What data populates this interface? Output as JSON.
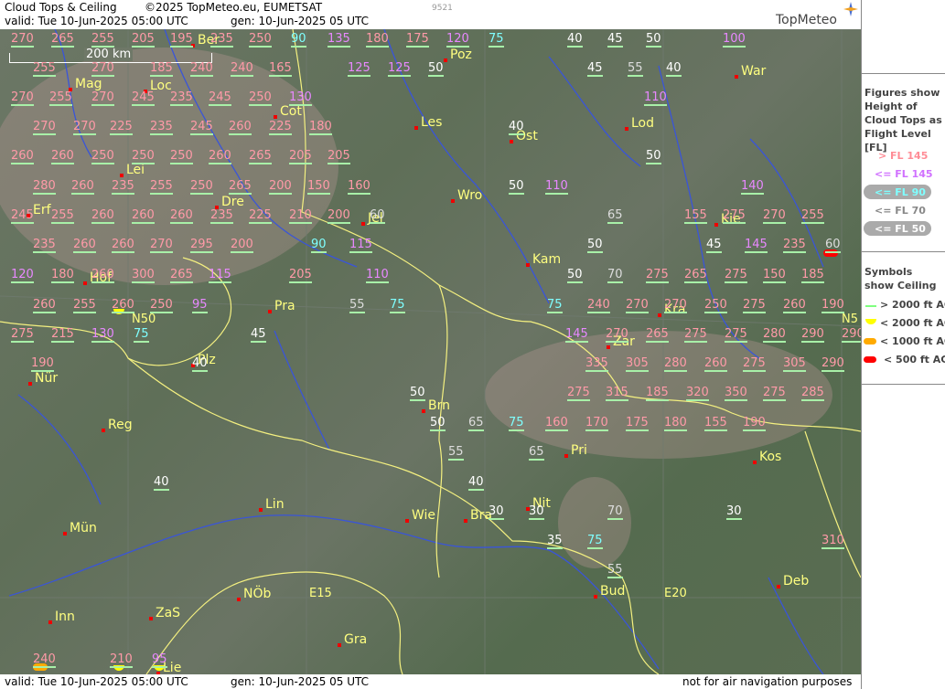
{
  "header": {
    "title": "Cloud Tops & Ceiling",
    "copyright": "©2025 TopMeteo.eu, EUMETSAT",
    "valid": "valid:  Tue   10-Jun-2025  05:00 UTC",
    "gen": "gen: 10-Jun-2025 05 UTC",
    "code": "9521",
    "brand": "TopMeteo"
  },
  "footer": {
    "valid": "valid:  Tue   10-Jun-2025  05:00 UTC",
    "gen": "gen: 10-Jun-2025 05 UTC",
    "disclaimer": "not for air navigation purposes"
  },
  "legend": {
    "figures_title": "Figures show Height of Cloud Tops as Flight Level  [FL]",
    "fl_items": [
      {
        "label": "> FL 145",
        "color": "#ff8c96"
      },
      {
        "label": "<= FL 145",
        "color": "#d070ff"
      },
      {
        "label": "<= FL 90",
        "color": "#7fffff"
      },
      {
        "label": "<= FL 70",
        "color": "#888888"
      },
      {
        "label": "<= FL 50",
        "color": "#ffffff"
      }
    ],
    "symbols_title": "Symbols show Ceiling",
    "ceiling_items": [
      {
        "label": "> 2000 ft AGL",
        "color": "#80ff80"
      },
      {
        "label": "< 2000 ft AGL",
        "color": "#ffff00"
      },
      {
        "label": "< 1000 ft AGL",
        "color": "#ffa500"
      },
      {
        "label": "< 500 ft AGL",
        "color": "#ff0000"
      }
    ]
  },
  "map": {
    "scale": "200 km",
    "lat_labels": [
      "N50",
      "N5"
    ],
    "lon_labels": [
      "E15",
      "E20"
    ],
    "cities": [
      {
        "name": "Ber"
      },
      {
        "name": "Poz"
      },
      {
        "name": "War"
      },
      {
        "name": "Mag"
      },
      {
        "name": "Loc"
      },
      {
        "name": "Cot"
      },
      {
        "name": "Les"
      },
      {
        "name": "Ost"
      },
      {
        "name": "Lod"
      },
      {
        "name": "Lei"
      },
      {
        "name": "Wro"
      },
      {
        "name": "Dre"
      },
      {
        "name": "Erf"
      },
      {
        "name": "Jel"
      },
      {
        "name": "Kie"
      },
      {
        "name": "Kam"
      },
      {
        "name": "Hof"
      },
      {
        "name": "Pra"
      },
      {
        "name": "Kra"
      },
      {
        "name": "Zar"
      },
      {
        "name": "Plz"
      },
      {
        "name": "Nür"
      },
      {
        "name": "Brn"
      },
      {
        "name": "Reg"
      },
      {
        "name": "Pri"
      },
      {
        "name": "Kos"
      },
      {
        "name": "Lin"
      },
      {
        "name": "Mün"
      },
      {
        "name": "Wie"
      },
      {
        "name": "Bra"
      },
      {
        "name": "Nit"
      },
      {
        "name": "Bud"
      },
      {
        "name": "NÖb"
      },
      {
        "name": "Deb"
      },
      {
        "name": "Inn"
      },
      {
        "name": "ZaS"
      },
      {
        "name": "Gra"
      },
      {
        "name": "Lie"
      }
    ],
    "values": [
      {
        "v": "270",
        "c": "pink"
      },
      {
        "v": "265",
        "c": "pink"
      },
      {
        "v": "255",
        "c": "pink"
      },
      {
        "v": "205",
        "c": "pink"
      },
      {
        "v": "195",
        "c": "pink"
      },
      {
        "v": "235",
        "c": "pink"
      },
      {
        "v": "250",
        "c": "pink"
      },
      {
        "v": "90",
        "c": "cyan"
      },
      {
        "v": "135",
        "c": "violet"
      },
      {
        "v": "180",
        "c": "pink"
      },
      {
        "v": "175",
        "c": "pink"
      },
      {
        "v": "120",
        "c": "violet"
      },
      {
        "v": "75",
        "c": "cyan"
      },
      {
        "v": "40",
        "c": "white"
      },
      {
        "v": "45",
        "c": "white"
      },
      {
        "v": "50",
        "c": "white"
      },
      {
        "v": "100",
        "c": "violet"
      },
      {
        "v": "255",
        "c": "pink"
      },
      {
        "v": "270",
        "c": "pink"
      },
      {
        "v": "185",
        "c": "pink"
      },
      {
        "v": "240",
        "c": "pink"
      },
      {
        "v": "240",
        "c": "pink"
      },
      {
        "v": "165",
        "c": "pink"
      },
      {
        "v": "125",
        "c": "violet"
      },
      {
        "v": "125",
        "c": "violet"
      },
      {
        "v": "50",
        "c": "white"
      },
      {
        "v": "45",
        "c": "white"
      },
      {
        "v": "55",
        "c": "grey"
      },
      {
        "v": "40",
        "c": "white"
      },
      {
        "v": "270",
        "c": "pink"
      },
      {
        "v": "255",
        "c": "pink"
      },
      {
        "v": "270",
        "c": "pink"
      },
      {
        "v": "245",
        "c": "pink"
      },
      {
        "v": "235",
        "c": "pink"
      },
      {
        "v": "245",
        "c": "pink"
      },
      {
        "v": "250",
        "c": "pink"
      },
      {
        "v": "130",
        "c": "violet"
      },
      {
        "v": "110",
        "c": "violet"
      },
      {
        "v": "270",
        "c": "pink"
      },
      {
        "v": "270",
        "c": "pink"
      },
      {
        "v": "225",
        "c": "pink"
      },
      {
        "v": "235",
        "c": "pink"
      },
      {
        "v": "245",
        "c": "pink"
      },
      {
        "v": "260",
        "c": "pink"
      },
      {
        "v": "225",
        "c": "pink"
      },
      {
        "v": "180",
        "c": "pink"
      },
      {
        "v": "40",
        "c": "white"
      },
      {
        "v": "260",
        "c": "pink"
      },
      {
        "v": "260",
        "c": "pink"
      },
      {
        "v": "250",
        "c": "pink"
      },
      {
        "v": "250",
        "c": "pink"
      },
      {
        "v": "250",
        "c": "pink"
      },
      {
        "v": "260",
        "c": "pink"
      },
      {
        "v": "265",
        "c": "pink"
      },
      {
        "v": "205",
        "c": "pink"
      },
      {
        "v": "205",
        "c": "pink"
      },
      {
        "v": "50",
        "c": "white"
      },
      {
        "v": "280",
        "c": "pink"
      },
      {
        "v": "260",
        "c": "pink"
      },
      {
        "v": "235",
        "c": "pink"
      },
      {
        "v": "255",
        "c": "pink"
      },
      {
        "v": "250",
        "c": "pink"
      },
      {
        "v": "265",
        "c": "pink"
      },
      {
        "v": "200",
        "c": "pink"
      },
      {
        "v": "150",
        "c": "pink"
      },
      {
        "v": "160",
        "c": "pink"
      },
      {
        "v": "50",
        "c": "white"
      },
      {
        "v": "110",
        "c": "violet"
      },
      {
        "v": "140",
        "c": "violet"
      },
      {
        "v": "245",
        "c": "pink"
      },
      {
        "v": "255",
        "c": "pink"
      },
      {
        "v": "260",
        "c": "pink"
      },
      {
        "v": "260",
        "c": "pink"
      },
      {
        "v": "260",
        "c": "pink"
      },
      {
        "v": "235",
        "c": "pink"
      },
      {
        "v": "225",
        "c": "pink"
      },
      {
        "v": "210",
        "c": "pink"
      },
      {
        "v": "200",
        "c": "pink"
      },
      {
        "v": "60",
        "c": "grey"
      },
      {
        "v": "65",
        "c": "grey"
      },
      {
        "v": "155",
        "c": "pink"
      },
      {
        "v": "275",
        "c": "pink"
      },
      {
        "v": "270",
        "c": "pink"
      },
      {
        "v": "255",
        "c": "pink"
      },
      {
        "v": "235",
        "c": "pink"
      },
      {
        "v": "260",
        "c": "pink"
      },
      {
        "v": "260",
        "c": "pink"
      },
      {
        "v": "270",
        "c": "pink"
      },
      {
        "v": "295",
        "c": "pink"
      },
      {
        "v": "200",
        "c": "pink"
      },
      {
        "v": "90",
        "c": "cyan"
      },
      {
        "v": "115",
        "c": "violet"
      },
      {
        "v": "50",
        "c": "white"
      },
      {
        "v": "45",
        "c": "white"
      },
      {
        "v": "145",
        "c": "violet"
      },
      {
        "v": "235",
        "c": "pink"
      },
      {
        "v": "60",
        "c": "grey"
      },
      {
        "v": "120",
        "c": "violet"
      },
      {
        "v": "180",
        "c": "pink"
      },
      {
        "v": "260",
        "c": "pink"
      },
      {
        "v": "300",
        "c": "pink"
      },
      {
        "v": "265",
        "c": "pink"
      },
      {
        "v": "115",
        "c": "violet"
      },
      {
        "v": "205",
        "c": "pink"
      },
      {
        "v": "110",
        "c": "violet"
      },
      {
        "v": "50",
        "c": "white"
      },
      {
        "v": "70",
        "c": "grey"
      },
      {
        "v": "275",
        "c": "pink"
      },
      {
        "v": "265",
        "c": "pink"
      },
      {
        "v": "275",
        "c": "pink"
      },
      {
        "v": "150",
        "c": "pink"
      },
      {
        "v": "185",
        "c": "pink"
      },
      {
        "v": "260",
        "c": "pink"
      },
      {
        "v": "255",
        "c": "pink"
      },
      {
        "v": "260",
        "c": "pink"
      },
      {
        "v": "250",
        "c": "pink"
      },
      {
        "v": "95",
        "c": "violet"
      },
      {
        "v": "55",
        "c": "grey"
      },
      {
        "v": "75",
        "c": "cyan"
      },
      {
        "v": "75",
        "c": "cyan"
      },
      {
        "v": "240",
        "c": "pink"
      },
      {
        "v": "270",
        "c": "pink"
      },
      {
        "v": "270",
        "c": "pink"
      },
      {
        "v": "250",
        "c": "pink"
      },
      {
        "v": "275",
        "c": "pink"
      },
      {
        "v": "260",
        "c": "pink"
      },
      {
        "v": "190",
        "c": "pink"
      },
      {
        "v": "275",
        "c": "pink"
      },
      {
        "v": "215",
        "c": "pink"
      },
      {
        "v": "130",
        "c": "violet"
      },
      {
        "v": "75",
        "c": "cyan"
      },
      {
        "v": "45",
        "c": "white"
      },
      {
        "v": "145",
        "c": "violet"
      },
      {
        "v": "270",
        "c": "pink"
      },
      {
        "v": "265",
        "c": "pink"
      },
      {
        "v": "275",
        "c": "pink"
      },
      {
        "v": "275",
        "c": "pink"
      },
      {
        "v": "280",
        "c": "pink"
      },
      {
        "v": "290",
        "c": "pink"
      },
      {
        "v": "290",
        "c": "pink"
      },
      {
        "v": "190",
        "c": "pink"
      },
      {
        "v": "40",
        "c": "white"
      },
      {
        "v": "335",
        "c": "pink"
      },
      {
        "v": "305",
        "c": "pink"
      },
      {
        "v": "280",
        "c": "pink"
      },
      {
        "v": "260",
        "c": "pink"
      },
      {
        "v": "275",
        "c": "pink"
      },
      {
        "v": "305",
        "c": "pink"
      },
      {
        "v": "290",
        "c": "pink"
      },
      {
        "v": "50",
        "c": "white"
      },
      {
        "v": "275",
        "c": "pink"
      },
      {
        "v": "315",
        "c": "pink"
      },
      {
        "v": "185",
        "c": "pink"
      },
      {
        "v": "320",
        "c": "pink"
      },
      {
        "v": "350",
        "c": "pink"
      },
      {
        "v": "275",
        "c": "pink"
      },
      {
        "v": "285",
        "c": "pink"
      },
      {
        "v": "50",
        "c": "white"
      },
      {
        "v": "65",
        "c": "grey"
      },
      {
        "v": "75",
        "c": "cyan"
      },
      {
        "v": "160",
        "c": "pink"
      },
      {
        "v": "170",
        "c": "pink"
      },
      {
        "v": "175",
        "c": "pink"
      },
      {
        "v": "180",
        "c": "pink"
      },
      {
        "v": "155",
        "c": "pink"
      },
      {
        "v": "190",
        "c": "pink"
      },
      {
        "v": "55",
        "c": "grey"
      },
      {
        "v": "65",
        "c": "grey"
      },
      {
        "v": "40",
        "c": "white"
      },
      {
        "v": "40",
        "c": "white"
      },
      {
        "v": "30",
        "c": "white"
      },
      {
        "v": "30",
        "c": "white"
      },
      {
        "v": "70",
        "c": "grey"
      },
      {
        "v": "30",
        "c": "white"
      },
      {
        "v": "35",
        "c": "white"
      },
      {
        "v": "75",
        "c": "cyan"
      },
      {
        "v": "310",
        "c": "pink"
      },
      {
        "v": "55",
        "c": "grey"
      },
      {
        "v": "240",
        "c": "pink"
      },
      {
        "v": "210",
        "c": "pink"
      },
      {
        "v": "95",
        "c": "violet"
      }
    ]
  }
}
